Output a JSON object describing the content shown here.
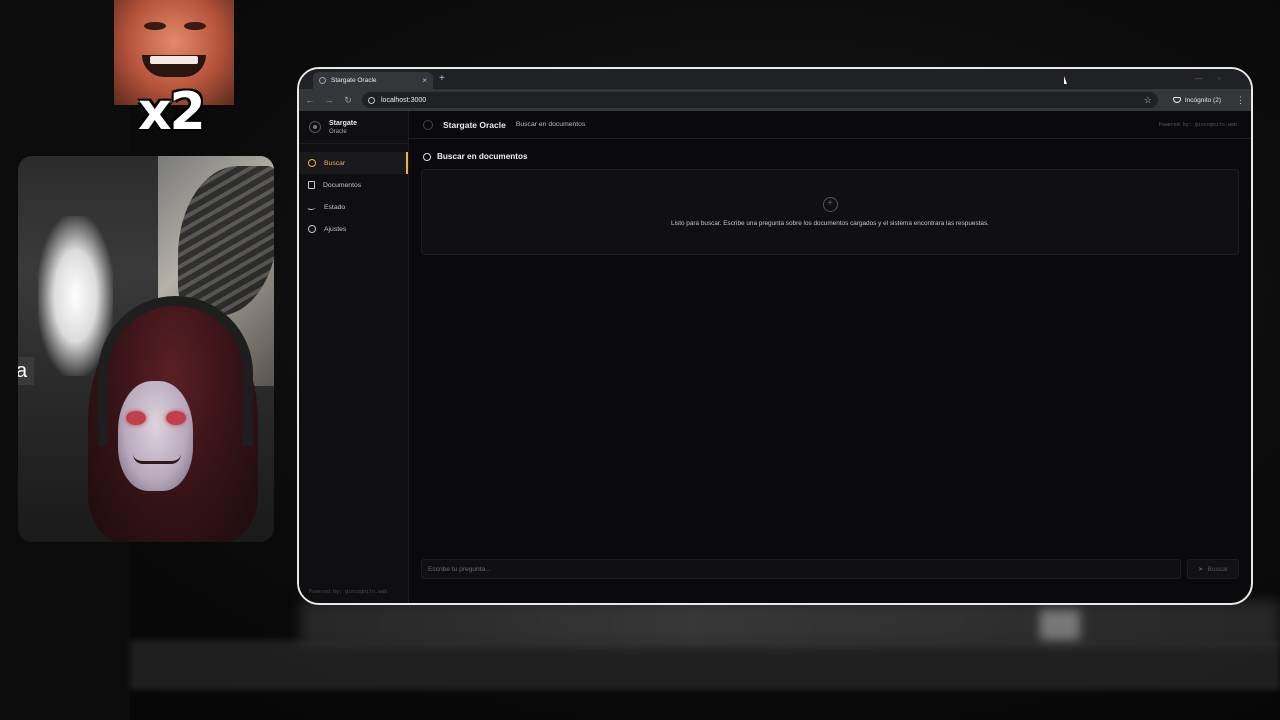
{
  "overlay": {
    "multiplier": "x2",
    "caption_fragment": "a"
  },
  "browser": {
    "tab_title": "Stargate Oracle",
    "new_tab": "+",
    "close_tab": "×",
    "url": "localhost:3000",
    "incognito_label": "Incógnito (2)"
  },
  "sidebar": {
    "brand_name": "Stargate",
    "brand_sub": "Oracle",
    "items": [
      {
        "label": "Buscar",
        "active": true
      },
      {
        "label": "Documentos"
      },
      {
        "label": "Estado"
      },
      {
        "label": "Ajustes"
      }
    ],
    "powered": "Powered by: @incognito.web"
  },
  "header": {
    "title": "Stargate Oracle",
    "subtitle": "Buscar en documentos",
    "powered": "Powered by: @incognito.web"
  },
  "main": {
    "section_title": "Buscar en documentos",
    "empty_message": "Listo para buscar. Escribe una pregunta sobre los documentos cargados y el sistema encontrara las respuestas.",
    "input_placeholder": "Escribe tu pregunta...",
    "search_button": "Buscar"
  },
  "colors": {
    "accent": "#e5b54a",
    "background": "#0a0a0c"
  }
}
